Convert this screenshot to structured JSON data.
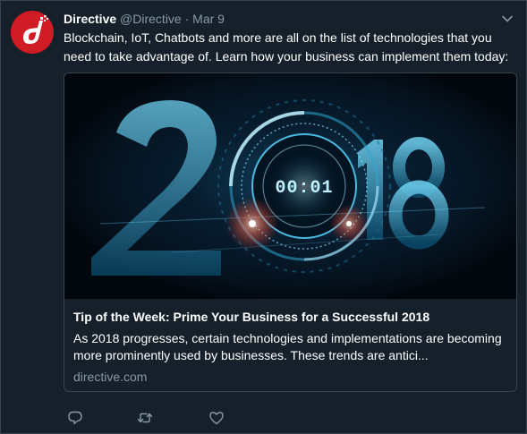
{
  "tweet": {
    "author_name": "Directive",
    "author_handle": "@Directive",
    "separator": "·",
    "date": "Mar 9",
    "text": "Blockchain, IoT, Chatbots and more are all on the list of technologies that you need to take advantage of. Learn how your business can implement them today:"
  },
  "card": {
    "title": "Tip of the Week: Prime Your Business for a Successful 2018",
    "description": "As 2018 progresses, certain technologies and implementations are becoming more prominently used by businesses. These trends are antici...",
    "domain": "directive.com",
    "image_year": "2018",
    "image_clock": "00:01"
  },
  "actions": {
    "reply_icon": "reply-icon",
    "retweet_icon": "retweet-icon",
    "like_icon": "like-icon"
  },
  "colors": {
    "background": "#15202b",
    "border": "#38444d",
    "secondary_text": "#8899a6",
    "avatar_red": "#d01c24"
  }
}
